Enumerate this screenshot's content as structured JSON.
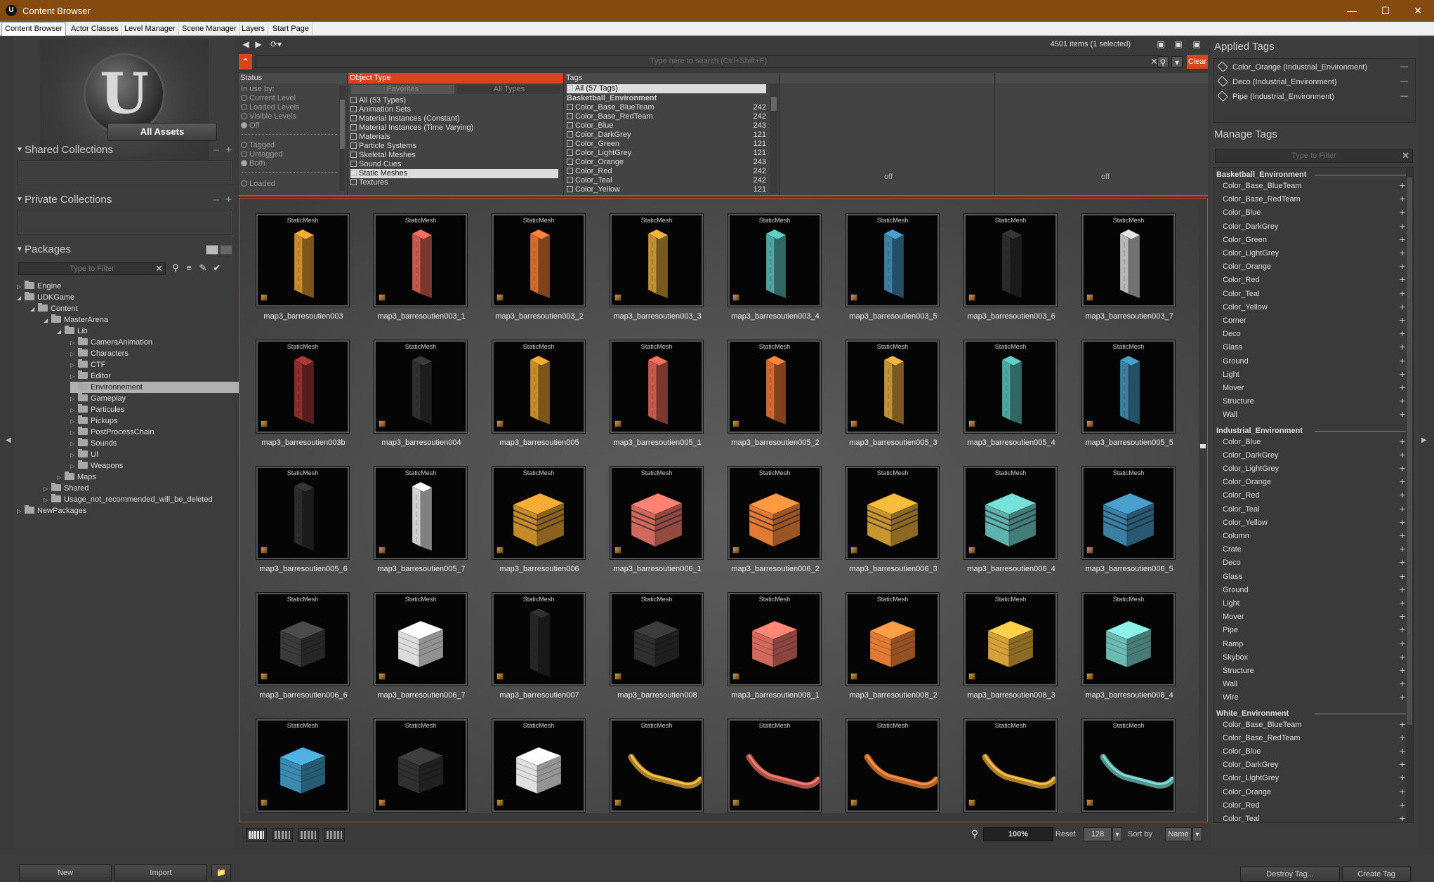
{
  "window": {
    "title": "Content Browser",
    "app_icon": "unreal-logo-icon"
  },
  "tabs": [
    {
      "label": "Content Browser",
      "active": true
    },
    {
      "label": "Actor Classes"
    },
    {
      "label": "Level Manager"
    },
    {
      "label": "Scene Manager"
    },
    {
      "label": "Layers"
    },
    {
      "label": "Start Page"
    }
  ],
  "left": {
    "all_assets": "All Assets",
    "shared_collections": "Shared Collections",
    "private_collections": "Private Collections",
    "packages": "Packages",
    "package_filter_placeholder": "Type to Filter",
    "tree": [
      {
        "label": "Engine",
        "depth": 0,
        "expanded": false
      },
      {
        "label": "UDKGame",
        "depth": 0,
        "expanded": true
      },
      {
        "label": "Content",
        "depth": 1,
        "expanded": true
      },
      {
        "label": "MasterArena",
        "depth": 2,
        "expanded": true
      },
      {
        "label": "Lib",
        "depth": 3,
        "expanded": true
      },
      {
        "label": "CameraAnimation",
        "depth": 4,
        "expanded": false
      },
      {
        "label": "Characters",
        "depth": 4,
        "expanded": false
      },
      {
        "label": "CTF",
        "depth": 4,
        "expanded": false
      },
      {
        "label": "Editor",
        "depth": 4,
        "expanded": false
      },
      {
        "label": "Environnement",
        "depth": 4,
        "expanded": false,
        "selected": true
      },
      {
        "label": "Gameplay",
        "depth": 4,
        "expanded": false
      },
      {
        "label": "Particules",
        "depth": 4,
        "expanded": false
      },
      {
        "label": "Pickups",
        "depth": 4,
        "expanded": false
      },
      {
        "label": "PostProcessChain",
        "depth": 4,
        "expanded": false
      },
      {
        "label": "Sounds",
        "depth": 4,
        "expanded": false
      },
      {
        "label": "UI",
        "depth": 4,
        "expanded": false
      },
      {
        "label": "Weapons",
        "depth": 4,
        "expanded": false
      },
      {
        "label": "Maps",
        "depth": 3,
        "expanded": false
      },
      {
        "label": "Shared",
        "depth": 2,
        "expanded": false
      },
      {
        "label": "Usage_not_recommended_will_be_deleted",
        "depth": 2,
        "expanded": false
      },
      {
        "label": "NewPackages",
        "depth": 0,
        "expanded": false
      }
    ],
    "new_button": "New",
    "import_button": "Import"
  },
  "center": {
    "item_count": "4501 items (1 selected)",
    "search_placeholder": "Type here to search  (Ctrl+Shift+F)",
    "clear": "Clear",
    "status": {
      "header": "Status",
      "in_use_by": "In use by:",
      "radios": [
        "Current Level",
        "Loaded Levels",
        "Visible Levels",
        "Off"
      ],
      "radios2": [
        "Tagged",
        "Untagged",
        "Both"
      ],
      "loaded": "Loaded"
    },
    "object_type": {
      "header": "Object Type",
      "tab_favorites": "Favorites",
      "tab_all": "All Types",
      "items": [
        {
          "label": "All (53 Types)",
          "checked": false
        },
        {
          "label": "Animation Sets",
          "checked": false
        },
        {
          "label": "Material Instances (Constant)",
          "checked": false
        },
        {
          "label": "Material Instances (Time Varying)",
          "checked": false
        },
        {
          "label": "Materials",
          "checked": false
        },
        {
          "label": "Particle Systems",
          "checked": false
        },
        {
          "label": "Skeletal Meshes",
          "checked": false
        },
        {
          "label": "Sound Cues",
          "checked": false
        },
        {
          "label": "Static Meshes",
          "checked": true
        },
        {
          "label": "Textures",
          "checked": false
        }
      ]
    },
    "tags": {
      "header": "Tags",
      "all": "All (57 Tags)",
      "group": "Basketball_Environment",
      "items": [
        {
          "label": "Color_Base_BlueTeam",
          "count": "242"
        },
        {
          "label": "Color_Base_RedTeam",
          "count": "242"
        },
        {
          "label": "Color_Blue",
          "count": "243"
        },
        {
          "label": "Color_DarkGrey",
          "count": "121"
        },
        {
          "label": "Color_Green",
          "count": "121"
        },
        {
          "label": "Color_LightGrey",
          "count": "121"
        },
        {
          "label": "Color_Orange",
          "count": "243"
        },
        {
          "label": "Color_Red",
          "count": "242"
        },
        {
          "label": "Color_Teal",
          "count": "242"
        },
        {
          "label": "Color_Yellow",
          "count": "121"
        }
      ]
    },
    "off1": "off",
    "off2": "off",
    "asset_type_label": "StaticMesh",
    "assets": [
      {
        "name": "map3_barresoutien003",
        "color": "#c98a2a",
        "shape": "pillar"
      },
      {
        "name": "map3_barresoutien003_1",
        "color": "#c55a4c",
        "shape": "pillar"
      },
      {
        "name": "map3_barresoutien003_2",
        "color": "#d06a30",
        "shape": "pillar"
      },
      {
        "name": "map3_barresoutien003_3",
        "color": "#c28f35",
        "shape": "pillar"
      },
      {
        "name": "map3_barresoutien003_4",
        "color": "#4fa5a0",
        "shape": "pillar"
      },
      {
        "name": "map3_barresoutien003_5",
        "color": "#3b7fa3",
        "shape": "pillar"
      },
      {
        "name": "map3_barresoutien003_6",
        "color": "#2b2b2b",
        "shape": "pillar"
      },
      {
        "name": "map3_barresoutien003_7",
        "color": "#b8b8b8",
        "shape": "pillar"
      },
      {
        "name": "map3_barresoutien003b",
        "color": "#8a2e2e",
        "shape": "pillar"
      },
      {
        "name": "map3_barresoutien004",
        "color": "#2f2f2f",
        "shape": "pillar"
      },
      {
        "name": "map3_barresoutien005",
        "color": "#c58a2a",
        "shape": "pillar"
      },
      {
        "name": "map3_barresoutien005_1",
        "color": "#c55a4c",
        "shape": "pillar"
      },
      {
        "name": "map3_barresoutien005_2",
        "color": "#d06a30",
        "shape": "pillar"
      },
      {
        "name": "map3_barresoutien005_3",
        "color": "#c29035",
        "shape": "pillar"
      },
      {
        "name": "map3_barresoutien005_4",
        "color": "#4fa5a0",
        "shape": "pillar"
      },
      {
        "name": "map3_barresoutien005_5",
        "color": "#3b7fa3",
        "shape": "pillar"
      },
      {
        "name": "map3_barresoutien005_6",
        "color": "#2b2b2b",
        "shape": "pillar"
      },
      {
        "name": "map3_barresoutien005_7",
        "color": "#d0d0d0",
        "shape": "pillar"
      },
      {
        "name": "map3_barresoutien006",
        "color": "#c58a2a",
        "shape": "box"
      },
      {
        "name": "map3_barresoutien006_1",
        "color": "#d0685c",
        "shape": "box"
      },
      {
        "name": "map3_barresoutien006_2",
        "color": "#e07a35",
        "shape": "box"
      },
      {
        "name": "map3_barresoutien006_3",
        "color": "#c8962f",
        "shape": "box"
      },
      {
        "name": "map3_barresoutien006_4",
        "color": "#5fb3ad",
        "shape": "box"
      },
      {
        "name": "map3_barresoutien006_5",
        "color": "#3b7fa3",
        "shape": "box"
      },
      {
        "name": "map3_barresoutien006_6",
        "color": "#3a3a3a",
        "shape": "cube"
      },
      {
        "name": "map3_barresoutien006_7",
        "color": "#dcdcdc",
        "shape": "cube"
      },
      {
        "name": "map3_barresoutien007",
        "color": "#262626",
        "shape": "pillar"
      },
      {
        "name": "map3_barresoutien008",
        "color": "#2e2e2e",
        "shape": "cube"
      },
      {
        "name": "map3_barresoutien008_1",
        "color": "#d0685c",
        "shape": "cube"
      },
      {
        "name": "map3_barresoutien008_2",
        "color": "#e07a35",
        "shape": "cube"
      },
      {
        "name": "map3_barresoutien008_3",
        "color": "#d4a03a",
        "shape": "cube"
      },
      {
        "name": "map3_barresoutien008_4",
        "color": "#6cbab3",
        "shape": "cube"
      },
      {
        "name": "",
        "color": "#3b8ab0",
        "shape": "cube"
      },
      {
        "name": "",
        "color": "#303030",
        "shape": "cube"
      },
      {
        "name": "",
        "color": "#e0e0e0",
        "shape": "cube"
      },
      {
        "name": "",
        "color": "#d4a03a",
        "shape": "pipe"
      },
      {
        "name": "",
        "color": "#d0685c",
        "shape": "pipe"
      },
      {
        "name": "",
        "color": "#e07a35",
        "shape": "pipe"
      },
      {
        "name": "",
        "color": "#d4a03a",
        "shape": "pipe"
      },
      {
        "name": "",
        "color": "#6cbab3",
        "shape": "pipe"
      }
    ],
    "zoom": "100%",
    "reset": "Reset",
    "size": "128",
    "sort_by": "Sort by",
    "sort_value": "Name"
  },
  "right": {
    "applied_tags": "Applied Tags",
    "applied": [
      "Color_Orange (Industrial_Environment)",
      "Deco (Industrial_Environment)",
      "Pipe (Industrial_Environment)"
    ],
    "manage_tags": "Manage Tags",
    "filter_placeholder": "Type to Filter",
    "groups": [
      {
        "name": "Basketball_Environment",
        "tags": [
          "Color_Base_BlueTeam",
          "Color_Base_RedTeam",
          "Color_Blue",
          "Color_DarkGrey",
          "Color_Green",
          "Color_LightGrey",
          "Color_Orange",
          "Color_Red",
          "Color_Teal",
          "Color_Yellow",
          "Corner",
          "Deco",
          "Glass",
          "Ground",
          "Light",
          "Mover",
          "Structure",
          "Wall"
        ]
      },
      {
        "name": "Industrial_Environment",
        "tags": [
          "Color_Blue",
          "Color_DarkGrey",
          "Color_LightGrey",
          "Color_Orange",
          "Color_Red",
          "Color_Teal",
          "Color_Yellow",
          "Column",
          "Crate",
          "Deco",
          "Glass",
          "Ground",
          "Light",
          "Mover",
          "Pipe",
          "Ramp",
          "Skybox",
          "Structure",
          "Wall",
          "Wire"
        ]
      },
      {
        "name": "White_Environment",
        "tags": [
          "Color_Base_BlueTeam",
          "Color_Base_RedTeam",
          "Color_Blue",
          "Color_DarkGrey",
          "Color_LightGrey",
          "Color_Orange",
          "Color_Red",
          "Color_Teal"
        ]
      }
    ],
    "destroy_tag": "Destroy Tag...",
    "create_tag": "Create Tag"
  },
  "colors": {
    "accent": "#d9441a",
    "titlebar": "#854a0f"
  }
}
